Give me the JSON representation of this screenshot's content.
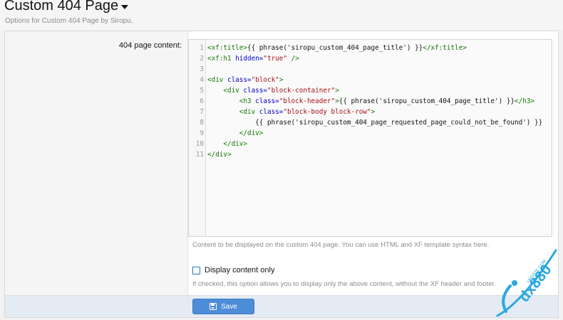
{
  "header": {
    "title": "Custom 404 Page",
    "description": "Options for Custom 404 Page by Siropu."
  },
  "form": {
    "content_label": "404 page content:",
    "code_lines": [
      {
        "num": "1",
        "parts": [
          [
            "tag",
            "<xf:title>"
          ],
          [
            "txt",
            "{{ phrase('siropu_custom_404_page_title') }}"
          ],
          [
            "tag",
            "</xf:title>"
          ]
        ]
      },
      {
        "num": "2",
        "parts": [
          [
            "tag",
            "<xf:h1 "
          ],
          [
            "attr",
            "hidden="
          ],
          [
            "str",
            "\"true\""
          ],
          [
            "tag",
            " />"
          ]
        ]
      },
      {
        "num": "3",
        "parts": []
      },
      {
        "num": "4",
        "parts": [
          [
            "tag",
            "<div "
          ],
          [
            "attr",
            "class="
          ],
          [
            "str",
            "\"block\""
          ],
          [
            "tag",
            ">"
          ]
        ]
      },
      {
        "num": "5",
        "parts": [
          [
            "txt",
            "    "
          ],
          [
            "tag",
            "<div "
          ],
          [
            "attr",
            "class="
          ],
          [
            "str",
            "\"block-container\""
          ],
          [
            "tag",
            ">"
          ]
        ]
      },
      {
        "num": "6",
        "parts": [
          [
            "txt",
            "        "
          ],
          [
            "tag",
            "<h3 "
          ],
          [
            "attr",
            "class="
          ],
          [
            "str",
            "\"block-header\""
          ],
          [
            "tag",
            ">"
          ],
          [
            "txt",
            "{{ phrase('siropu_custom_404_page_title') }}"
          ],
          [
            "tag",
            "</h3>"
          ]
        ]
      },
      {
        "num": "7",
        "parts": [
          [
            "txt",
            "        "
          ],
          [
            "tag",
            "<div "
          ],
          [
            "attr",
            "class="
          ],
          [
            "str",
            "\"block-body block-row\""
          ],
          [
            "tag",
            ">"
          ]
        ]
      },
      {
        "num": "8",
        "parts": [
          [
            "txt",
            "            {{ phrase('siropu_custom_404_page_requested_page_could_not_be_found') }}"
          ]
        ]
      },
      {
        "num": "9",
        "parts": [
          [
            "txt",
            "        "
          ],
          [
            "tag",
            "</div>"
          ]
        ]
      },
      {
        "num": "10",
        "parts": [
          [
            "txt",
            "    "
          ],
          [
            "tag",
            "</div>"
          ]
        ]
      },
      {
        "num": "11",
        "parts": [
          [
            "tag",
            "</div>"
          ]
        ]
      }
    ],
    "content_explain": "Content to be displayed on the custom 404 page. You can use HTML and XF template syntax here.",
    "checkbox_label": "Display content only",
    "checkbox_checked": false,
    "checkbox_explain": "If checked, this option allows you to display only the above content, without the XF header and footer.",
    "save_label": "Save"
  },
  "watermark": {
    "text": "dx880",
    "small_text": "UPDATE.COM",
    "color": "#2aa8e0"
  }
}
